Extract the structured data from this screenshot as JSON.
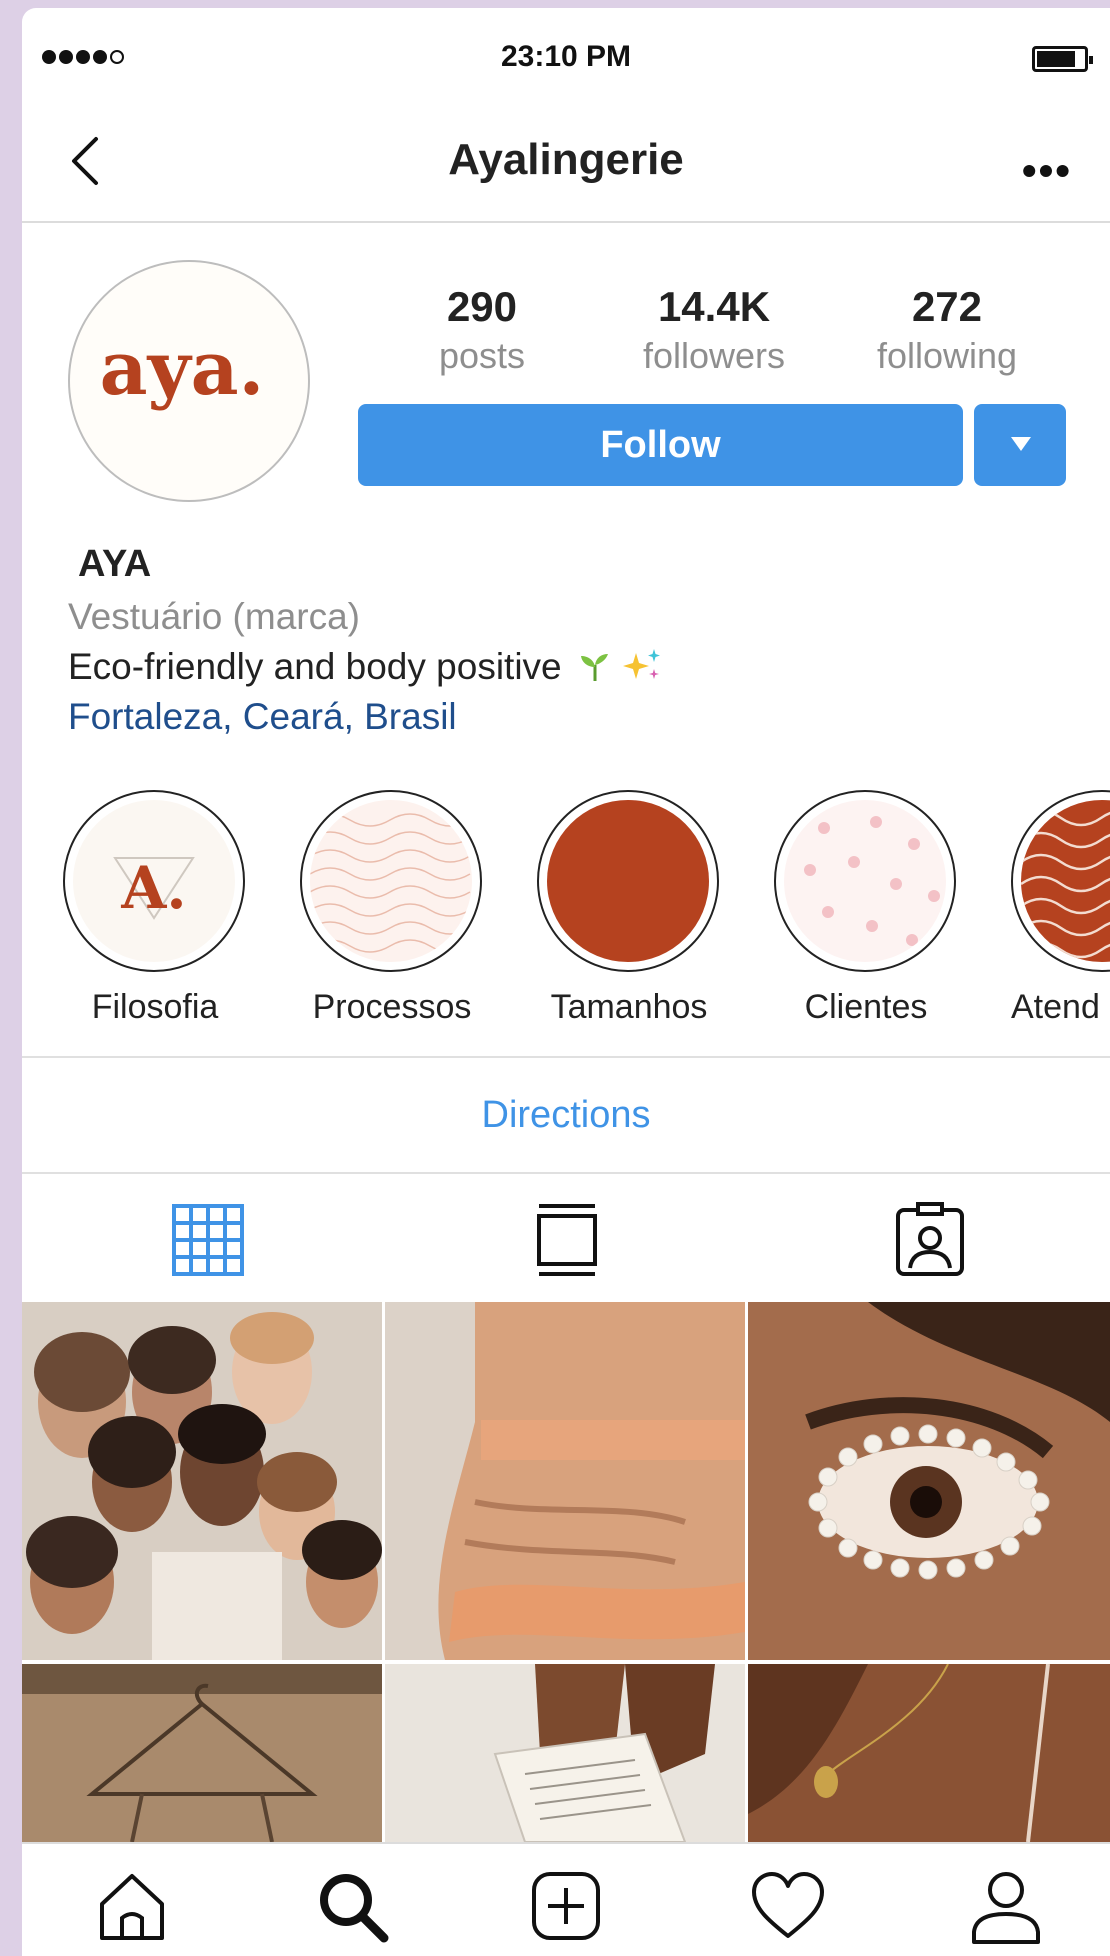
{
  "status_bar": {
    "time": "23:10 PM",
    "signal_icon": "signal-dots-icon",
    "battery_icon": "battery-icon"
  },
  "header": {
    "title": "Ayalingerie",
    "back_icon": "chevron-left-icon",
    "more_icon": "more-horizontal-icon",
    "more_label": "•••"
  },
  "profile": {
    "avatar_text": "aya.",
    "posts_count": "290",
    "posts_label": "posts",
    "followers_count": "14.4K",
    "followers_label": "followers",
    "following_count": "272",
    "following_label": "following",
    "follow_label": "Follow",
    "dropdown_icon": "caret-down-icon",
    "name": "AYA",
    "category": "Vestuário (marca)",
    "bio": "Eco-friendly and body positive",
    "bio_icons": [
      "seedling-icon",
      "sparkles-icon"
    ],
    "location": "Fortaleza, Ceará, Brasil"
  },
  "highlights": [
    {
      "label": "Filosofia",
      "mark": "A."
    },
    {
      "label": "Processos"
    },
    {
      "label": "Tamanhos"
    },
    {
      "label": "Clientes"
    },
    {
      "label": "Atend"
    }
  ],
  "directions_label": "Directions",
  "tabs": [
    "grid-icon",
    "feed-icon",
    "tagged-icon"
  ],
  "bottom_nav": [
    "home-icon",
    "search-icon",
    "add-post-icon",
    "heart-icon",
    "profile-icon"
  ],
  "colors": {
    "accent_blue": "#3f93e6",
    "brand_rust": "#b5421f",
    "location_blue": "#1f4e8c",
    "muted_gray": "#8e8e8e",
    "background_lilac": "#ddd0e6"
  }
}
